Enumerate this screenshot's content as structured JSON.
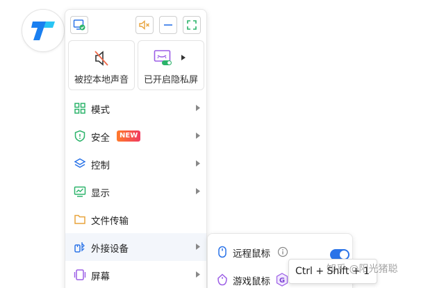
{
  "toolbar": {
    "monitor_icon": "monitor-check-icon",
    "mute_icon": "speaker-muted-icon",
    "minimize_icon": "minimize-icon",
    "fullscreen_icon": "fullscreen-icon"
  },
  "tiles": [
    {
      "label": "被控本地声音",
      "icon": "speaker-off-icon"
    },
    {
      "label": "已开启隐私屏",
      "icon": "privacy-screen-icon"
    }
  ],
  "menu": {
    "items": [
      {
        "label": "模式",
        "icon": "grid-icon"
      },
      {
        "label": "安全",
        "icon": "shield-icon",
        "badge": "NEW"
      },
      {
        "label": "控制",
        "icon": "layers-icon"
      },
      {
        "label": "显示",
        "icon": "chart-monitor-icon"
      },
      {
        "label": "文件传输",
        "icon": "folder-icon"
      },
      {
        "label": "外接设备",
        "icon": "devices-icon"
      },
      {
        "label": "屏幕",
        "icon": "screen-icon"
      }
    ]
  },
  "submenu": {
    "items": [
      {
        "label": "远程鼠标",
        "icon": "mouse-icon",
        "toggle_on": true
      },
      {
        "label": "游戏鼠标",
        "icon": "game-mouse-icon",
        "badge": "G"
      }
    ]
  },
  "tooltip": {
    "text": "Ctrl + Shift + 1"
  },
  "watermark": {
    "text": "知乎 @阳光猪聪"
  },
  "colors": {
    "accent": "#2a73e8",
    "green": "#2bb36a",
    "orange": "#e8a33b",
    "purple": "#9b5de5"
  }
}
